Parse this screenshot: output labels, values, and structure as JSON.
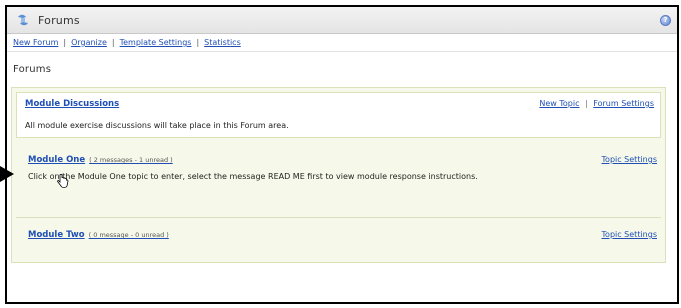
{
  "window": {
    "title": "Forums",
    "icon": "tools-icon",
    "help_icon": "help-icon",
    "help_glyph": "?"
  },
  "toolbar": {
    "links": [
      "New Forum",
      "Organize",
      "Template Settings",
      "Statistics"
    ],
    "separator": "|"
  },
  "page": {
    "section_title": "Forums"
  },
  "forum": {
    "title": "Module Discussions",
    "description": "All module exercise discussions will take place in this Forum area.",
    "actions": {
      "new_topic": "New Topic",
      "separator": "|",
      "forum_settings": "Forum Settings"
    }
  },
  "topics": [
    {
      "title": "Module One",
      "meta": "( 2 messages - 1 unread )",
      "description": "Click on the Module One topic to enter, select the message READ ME first to view module response instructions.",
      "action": "Topic Settings"
    },
    {
      "title": "Module Two",
      "meta": "( 0 message - 0 unread )",
      "action": "Topic Settings"
    }
  ],
  "colors": {
    "link": "#1f4fb5",
    "panel_bg": "#f6f9e9",
    "panel_border": "#dbe2bb"
  }
}
